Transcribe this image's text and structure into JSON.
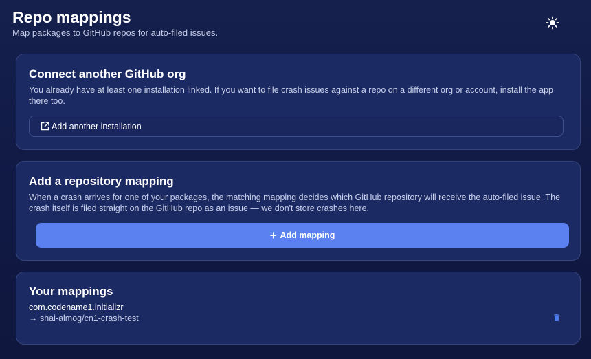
{
  "header": {
    "title": "Repo mappings",
    "subtitle": "Map packages to GitHub repos for auto-filed issues.",
    "theme_icon": "sun-icon"
  },
  "connect_card": {
    "title": "Connect another GitHub org",
    "description": "You already have at least one installation linked. If you want to file crash issues against a repo on a different org or account, install the app there too.",
    "button_label": "Add another installation",
    "button_icon": "external-link-icon"
  },
  "add_card": {
    "title": "Add a repository mapping",
    "description": "When a crash arrives for one of your packages, the matching mapping decides which GitHub repository will receive the auto-filed issue. The crash itself is filed straight on the GitHub repo as an issue — we don't store crashes here.",
    "button_label": "Add mapping",
    "button_icon": "plus-icon"
  },
  "mappings_card": {
    "title": "Your mappings",
    "items": [
      {
        "package": "com.codename1.initializr",
        "repo": "→ shai-almog/cn1-crash-test",
        "delete_icon": "trash-icon"
      }
    ]
  },
  "colors": {
    "background": "#131d48",
    "card": "#1c2a63",
    "card_border": "#35447e",
    "accent": "#5b80f0",
    "delete_icon": "#4d7bf0"
  }
}
